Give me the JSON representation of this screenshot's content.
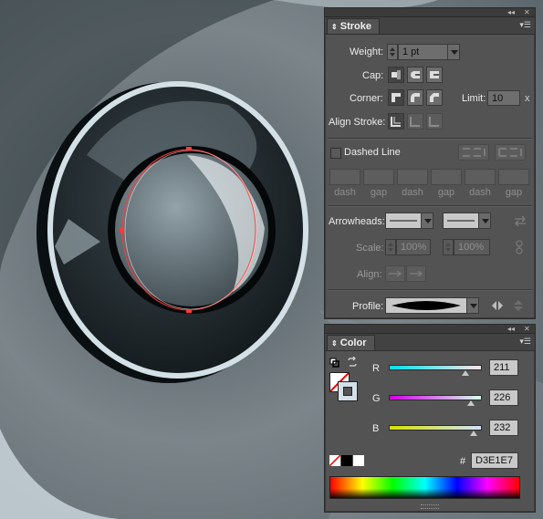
{
  "stroke_panel": {
    "tab_label": "Stroke",
    "weight_label": "Weight:",
    "weight_value": "1 pt",
    "cap_label": "Cap:",
    "corner_label": "Corner:",
    "limit_label": "Limit:",
    "limit_value": "10",
    "limit_unit": "x",
    "align_label": "Align Stroke:",
    "dashed_label": "Dashed Line",
    "dash_labels": [
      "dash",
      "gap",
      "dash",
      "gap",
      "dash",
      "gap"
    ],
    "arrowheads_label": "Arrowheads:",
    "scale_label": "Scale:",
    "scale_start": "100%",
    "scale_end": "100%",
    "align_arrow_label": "Align:",
    "profile_label": "Profile:"
  },
  "color_panel": {
    "tab_label": "Color",
    "r_label": "R",
    "g_label": "G",
    "b_label": "B",
    "r_value": "211",
    "g_value": "226",
    "b_value": "232",
    "r_level": 0.827,
    "g_level": 0.886,
    "b_level": 0.91,
    "hex_label": "#",
    "hex_value": "D3E1E7"
  },
  "colors": {
    "panel_bg": "#535353",
    "stroke_color": "#D3E1E7",
    "selection_red": "#ff3b3b"
  }
}
